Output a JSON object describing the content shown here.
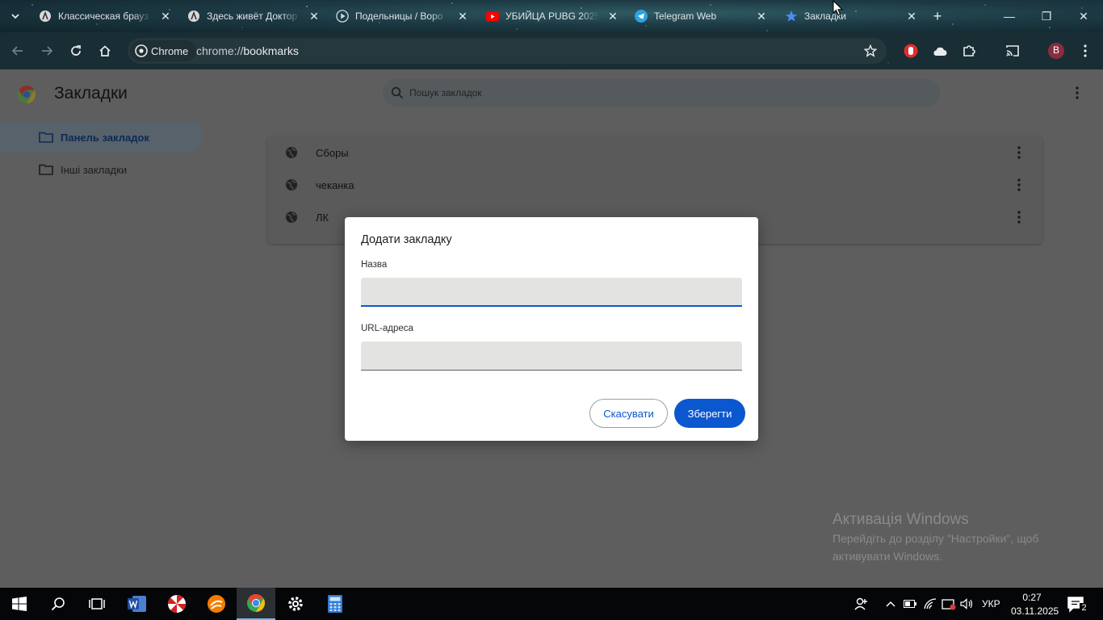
{
  "browser": {
    "tabs": [
      {
        "title": "Классическая брауз",
        "favicon": "site-icon",
        "active": false
      },
      {
        "title": "Здесь живёт Доктор",
        "favicon": "site-icon",
        "active": false
      },
      {
        "title": "Подельницы / Воро",
        "favicon": "play-icon",
        "active": false
      },
      {
        "title": "УБИЙЦА PUBG 2025",
        "favicon": "youtube-icon",
        "active": false
      },
      {
        "title": "Telegram Web",
        "favicon": "telegram-icon",
        "active": false
      },
      {
        "title": "Закладки",
        "favicon": "star-icon",
        "active": true
      }
    ],
    "omnibox": {
      "chip_label": "Chrome",
      "url_scheme": "chrome://",
      "url_path": "bookmarks"
    },
    "profile_initial": "B"
  },
  "bookmarks_page": {
    "title": "Закладки",
    "search_placeholder": "Пошук закладок",
    "nav": [
      {
        "label": "Панель закладок",
        "selected": true
      },
      {
        "label": "Інші закладки",
        "selected": false
      }
    ],
    "items": [
      {
        "title": "Сборы"
      },
      {
        "title": "чеканка"
      },
      {
        "title": "ЛК"
      }
    ]
  },
  "dialog": {
    "title": "Додати закладку",
    "name_label": "Назва",
    "name_value": "",
    "url_label": "URL-адреса",
    "url_value": "",
    "cancel_label": "Скасувати",
    "save_label": "Зберегти"
  },
  "watermark": {
    "heading": "Активація Windows",
    "line1": "Перейдіть до розділу \"Настройки\", щоб",
    "line2": "активувати Windows."
  },
  "taskbar": {
    "language": "УКР",
    "time": "0:27",
    "date": "03.11.2025",
    "notifications_count": "2"
  },
  "colors": {
    "accent": "#0b57d0",
    "page_overlay": "#5e5e5e",
    "taskbar": "#050608"
  }
}
